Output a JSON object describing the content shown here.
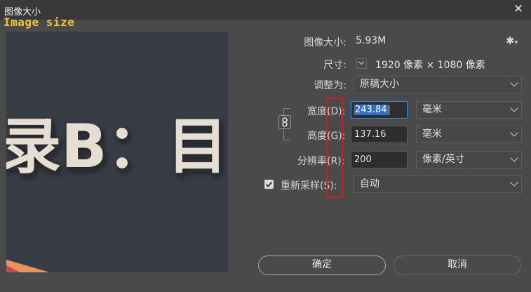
{
  "window": {
    "title": "图像大小",
    "overlay_label": "Image size"
  },
  "preview": {
    "text": "录B：目录"
  },
  "info": {
    "image_size_label": "图像大小:",
    "image_size_value": "5.93M",
    "dimensions_label": "尺寸:",
    "dimensions_value": "1920 像素  ×  1080 像素"
  },
  "fit_to": {
    "label": "调整为:",
    "value": "原稿大小"
  },
  "width": {
    "label": "宽度(D):",
    "value": "243.84",
    "unit": "毫米"
  },
  "height": {
    "label": "高度(G):",
    "value": "137.16",
    "unit": "毫米"
  },
  "resolution": {
    "label": "分辨率(R):",
    "value": "200",
    "unit": "像素/英寸"
  },
  "resample": {
    "label": "重新采样(S):",
    "value": "自动",
    "checked": true
  },
  "buttons": {
    "ok": "确定",
    "cancel": "取消"
  },
  "colors": {
    "accent": "#3b8de0",
    "highlight": "#d11f1f",
    "background": "#4a4a4a"
  }
}
